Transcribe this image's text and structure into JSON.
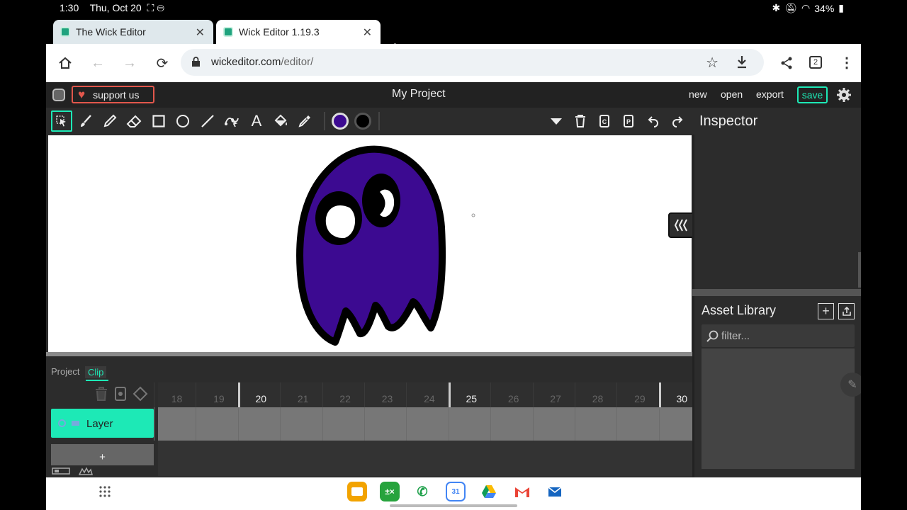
{
  "status_bar": {
    "time": "1:30",
    "date": "Thu, Oct 20",
    "battery": "34%"
  },
  "browser": {
    "tabs": [
      {
        "title": "The Wick Editor"
      },
      {
        "title": "Wick Editor 1.19.3"
      }
    ],
    "new_tab": "+",
    "url_host": "wickeditor.com",
    "url_path": "/editor/",
    "tab_count": "2"
  },
  "editor": {
    "support_label": "support us",
    "project_name": "My Project",
    "menu": {
      "new": "new",
      "open": "open",
      "export": "export",
      "save": "save"
    },
    "accent_color": "#1de9b6",
    "fill_color": "#3c0a91",
    "stroke_color": "#000000",
    "tools": [
      "cursor-icon",
      "brush-icon",
      "pencil-icon",
      "eraser-icon",
      "rectangle-icon",
      "ellipse-icon",
      "line-icon",
      "path-cursor-icon",
      "text-icon",
      "fill-bucket-icon",
      "eyedropper-icon"
    ]
  },
  "inspector": {
    "title": "Inspector"
  },
  "asset_library": {
    "title": "Asset Library",
    "filter_placeholder": "filter..."
  },
  "timeline": {
    "tabs": [
      "Project",
      "Clip"
    ],
    "active_tab": "Clip",
    "frame_numbers": [
      "18",
      "19",
      "20",
      "21",
      "22",
      "23",
      "24",
      "25",
      "26",
      "27",
      "28",
      "29",
      "30"
    ],
    "major_frames": [
      "20",
      "25",
      "30"
    ],
    "layer_name": "Layer",
    "add_layer": "+"
  },
  "dock": {
    "apps": [
      "My Files",
      "Calculator",
      "Phone",
      "Calendar",
      "Drive",
      "Gmail",
      "Email"
    ],
    "calendar_day": "31"
  }
}
